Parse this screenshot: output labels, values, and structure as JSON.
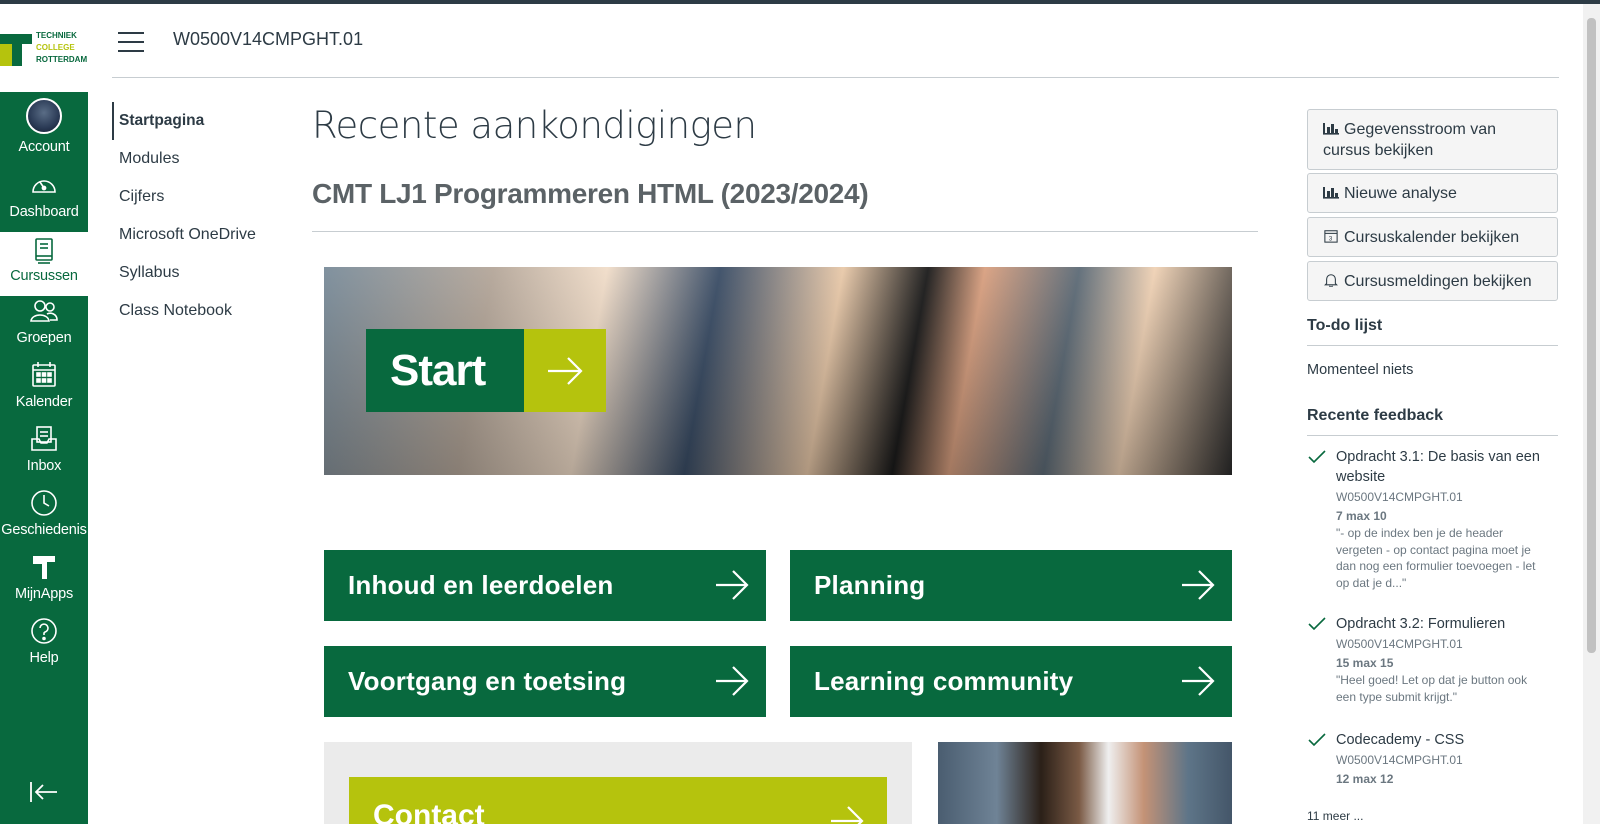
{
  "brand": {
    "logo_lines": [
      "TECHNIEK",
      "COLLEGE",
      "ROTTERDAM"
    ],
    "primary_color": "#08693e",
    "accent_color": "#b5c30d"
  },
  "global_nav": {
    "items": [
      {
        "label": "Account",
        "icon": "avatar"
      },
      {
        "label": "Dashboard",
        "icon": "dashboard-icon"
      },
      {
        "label": "Cursussen",
        "icon": "courses-icon",
        "active": true
      },
      {
        "label": "Groepen",
        "icon": "groups-icon"
      },
      {
        "label": "Kalender",
        "icon": "calendar-icon"
      },
      {
        "label": "Inbox",
        "icon": "inbox-icon"
      },
      {
        "label": "Geschiedenis",
        "icon": "history-icon"
      },
      {
        "label": "MijnApps",
        "icon": "apps-icon"
      },
      {
        "label": "Help",
        "icon": "help-icon"
      }
    ]
  },
  "header": {
    "course_code": "W0500V14CMPGHT.01"
  },
  "course_nav": {
    "items": [
      "Startpagina",
      "Modules",
      "Cijfers",
      "Microsoft OneDrive",
      "Syllabus",
      "Class Notebook"
    ],
    "active": "Startpagina"
  },
  "main": {
    "heading": "Recente aankondigingen",
    "course_title": "CMT LJ1 Programmeren HTML (2023/2024)",
    "start_button": "Start",
    "tiles": [
      "Inhoud en leerdoelen",
      "Planning",
      "Voortgang en toetsing",
      "Learning community"
    ],
    "contact_button": "Contact"
  },
  "right_sidebar": {
    "buttons": [
      {
        "label": "Gegevensstroom van cursus bekijken",
        "icon": "chart-icon"
      },
      {
        "label": "Nieuwe analyse",
        "icon": "chart-icon"
      },
      {
        "label": "Cursuskalender bekijken",
        "icon": "calendar-icon"
      },
      {
        "label": "Cursusmeldingen bekijken",
        "icon": "bell-icon"
      }
    ],
    "todo_heading": "To-do lijst",
    "todo_empty": "Momenteel niets",
    "feedback_heading": "Recente feedback",
    "feedback": [
      {
        "title": "Opdracht 3.1: De basis van een website",
        "course": "W0500V14CMPGHT.01",
        "score": "7 max 10",
        "comment": "\"- op de index ben je de header vergeten - op contact pagina moet je dan nog een formulier toevoegen - let op dat je d...\""
      },
      {
        "title": "Opdracht 3.2: Formulieren",
        "course": "W0500V14CMPGHT.01",
        "score": "15 max 15",
        "comment": "\"Heel goed! Let op dat je button ook een type submit krijgt.\""
      },
      {
        "title": "Codecademy - CSS",
        "course": "W0500V14CMPGHT.01",
        "score": "12 max 12",
        "comment": ""
      }
    ],
    "more_link": "11 meer ..."
  }
}
